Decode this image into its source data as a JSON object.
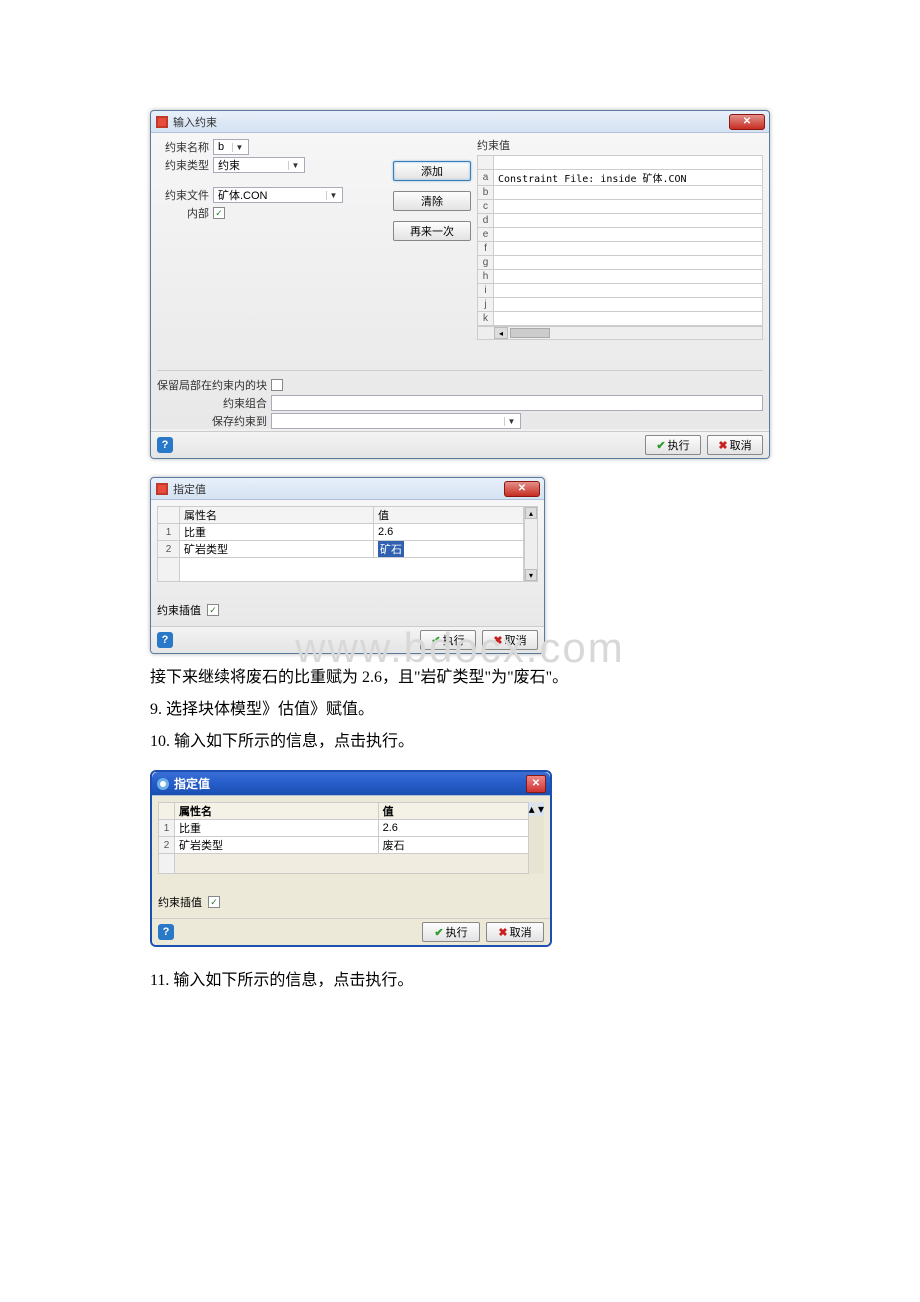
{
  "dialog1": {
    "title": "输入约束",
    "left": {
      "name_label": "约束名称",
      "name_value": "b",
      "type_label": "约束类型",
      "type_value": "约束",
      "file_label": "约束文件",
      "file_value": "矿体.CON",
      "inside_label": "内部"
    },
    "buttons": {
      "add": "添加",
      "clear": "清除",
      "again": "再来一次"
    },
    "right": {
      "group_label": "约束值",
      "rows": [
        "a",
        "b",
        "c",
        "d",
        "e",
        "f",
        "g",
        "h",
        "i",
        "j",
        "k"
      ],
      "row_a": "Constraint File: inside 矿体.CON"
    },
    "bottom": {
      "keep_partial": "保留局部在约束内的块",
      "combo_label": "约束组合",
      "save_to": "保存约束到"
    },
    "actions": {
      "execute": "执行",
      "cancel": "取消"
    }
  },
  "dialog2": {
    "title": "指定值",
    "headers": {
      "attr": "属性名",
      "val": "值"
    },
    "rows": [
      {
        "idx": "1",
        "attr": "比重",
        "val": "2.6"
      },
      {
        "idx": "2",
        "attr": "矿岩类型",
        "val": "矿石"
      }
    ],
    "constraint_interpolate": "约束插值",
    "actions": {
      "execute": "执行",
      "cancel": "取消"
    }
  },
  "watermark": "www.bdocx.com",
  "prose": {
    "p1": "接下来继续将废石的比重赋为 2.6，且\"岩矿类型\"为\"废石\"。",
    "p2": "9. 选择块体模型》估值》赋值。",
    "p3": "10. 输入如下所示的信息，点击执行。"
  },
  "dialog3": {
    "title": "指定值",
    "headers": {
      "attr": "属性名",
      "val": "值"
    },
    "rows": [
      {
        "idx": "1",
        "attr": "比重",
        "val": "2.6"
      },
      {
        "idx": "2",
        "attr": "矿岩类型",
        "val": "废石"
      }
    ],
    "constraint_interpolate": "约束插值",
    "actions": {
      "execute": "执行",
      "cancel": "取消"
    }
  },
  "prose2": {
    "p4": "11. 输入如下所示的信息，点击执行。"
  }
}
